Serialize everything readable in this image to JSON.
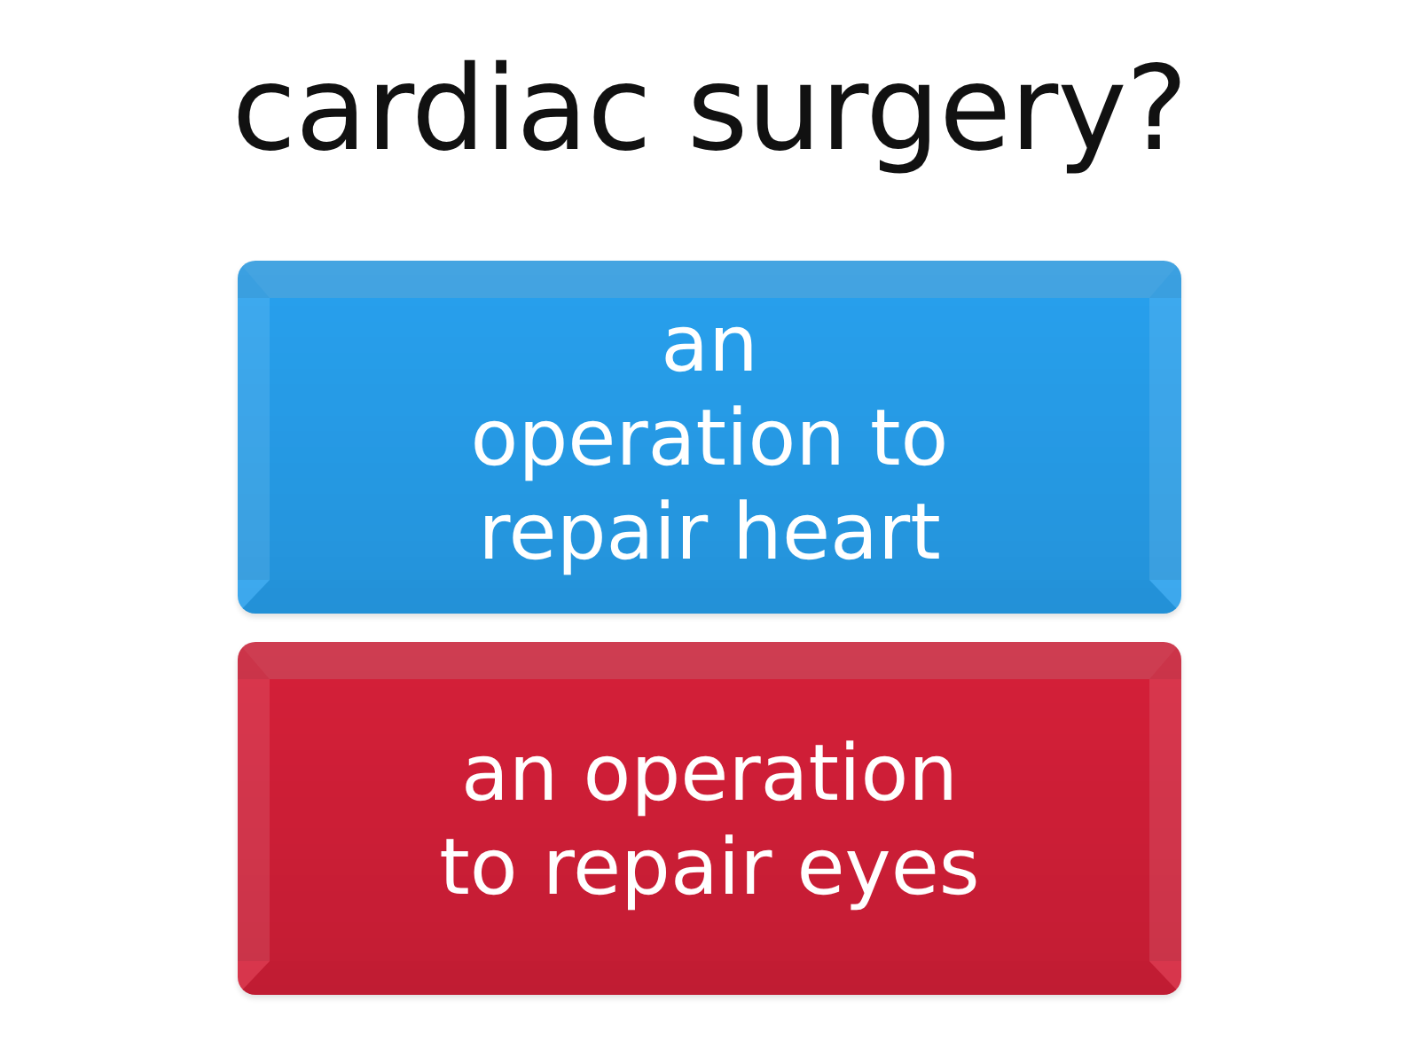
{
  "question": {
    "text": "cardiac surgery?"
  },
  "options": [
    {
      "text": "an\noperation to\nrepair heart",
      "color": "#279fec"
    },
    {
      "text": "an operation\nto repair eyes",
      "color": "#d31f38"
    }
  ]
}
